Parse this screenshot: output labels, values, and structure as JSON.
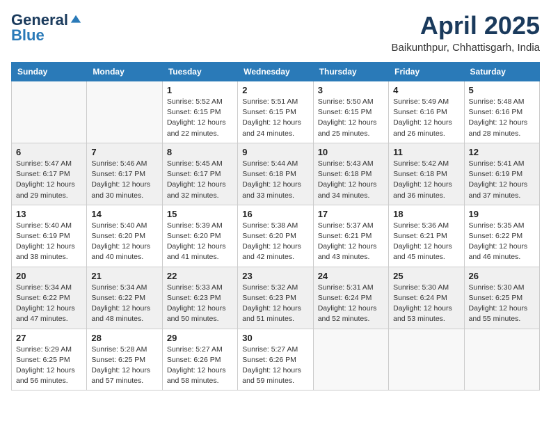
{
  "logo": {
    "general": "General",
    "blue": "Blue"
  },
  "header": {
    "title": "April 2025",
    "subtitle": "Baikunthpur, Chhattisgarh, India"
  },
  "weekdays": [
    "Sunday",
    "Monday",
    "Tuesday",
    "Wednesday",
    "Thursday",
    "Friday",
    "Saturday"
  ],
  "weeks": [
    [
      {
        "day": "",
        "sunrise": "",
        "sunset": "",
        "daylight": ""
      },
      {
        "day": "",
        "sunrise": "",
        "sunset": "",
        "daylight": ""
      },
      {
        "day": "1",
        "sunrise": "Sunrise: 5:52 AM",
        "sunset": "Sunset: 6:15 PM",
        "daylight": "Daylight: 12 hours and 22 minutes."
      },
      {
        "day": "2",
        "sunrise": "Sunrise: 5:51 AM",
        "sunset": "Sunset: 6:15 PM",
        "daylight": "Daylight: 12 hours and 24 minutes."
      },
      {
        "day": "3",
        "sunrise": "Sunrise: 5:50 AM",
        "sunset": "Sunset: 6:15 PM",
        "daylight": "Daylight: 12 hours and 25 minutes."
      },
      {
        "day": "4",
        "sunrise": "Sunrise: 5:49 AM",
        "sunset": "Sunset: 6:16 PM",
        "daylight": "Daylight: 12 hours and 26 minutes."
      },
      {
        "day": "5",
        "sunrise": "Sunrise: 5:48 AM",
        "sunset": "Sunset: 6:16 PM",
        "daylight": "Daylight: 12 hours and 28 minutes."
      }
    ],
    [
      {
        "day": "6",
        "sunrise": "Sunrise: 5:47 AM",
        "sunset": "Sunset: 6:17 PM",
        "daylight": "Daylight: 12 hours and 29 minutes."
      },
      {
        "day": "7",
        "sunrise": "Sunrise: 5:46 AM",
        "sunset": "Sunset: 6:17 PM",
        "daylight": "Daylight: 12 hours and 30 minutes."
      },
      {
        "day": "8",
        "sunrise": "Sunrise: 5:45 AM",
        "sunset": "Sunset: 6:17 PM",
        "daylight": "Daylight: 12 hours and 32 minutes."
      },
      {
        "day": "9",
        "sunrise": "Sunrise: 5:44 AM",
        "sunset": "Sunset: 6:18 PM",
        "daylight": "Daylight: 12 hours and 33 minutes."
      },
      {
        "day": "10",
        "sunrise": "Sunrise: 5:43 AM",
        "sunset": "Sunset: 6:18 PM",
        "daylight": "Daylight: 12 hours and 34 minutes."
      },
      {
        "day": "11",
        "sunrise": "Sunrise: 5:42 AM",
        "sunset": "Sunset: 6:18 PM",
        "daylight": "Daylight: 12 hours and 36 minutes."
      },
      {
        "day": "12",
        "sunrise": "Sunrise: 5:41 AM",
        "sunset": "Sunset: 6:19 PM",
        "daylight": "Daylight: 12 hours and 37 minutes."
      }
    ],
    [
      {
        "day": "13",
        "sunrise": "Sunrise: 5:40 AM",
        "sunset": "Sunset: 6:19 PM",
        "daylight": "Daylight: 12 hours and 38 minutes."
      },
      {
        "day": "14",
        "sunrise": "Sunrise: 5:40 AM",
        "sunset": "Sunset: 6:20 PM",
        "daylight": "Daylight: 12 hours and 40 minutes."
      },
      {
        "day": "15",
        "sunrise": "Sunrise: 5:39 AM",
        "sunset": "Sunset: 6:20 PM",
        "daylight": "Daylight: 12 hours and 41 minutes."
      },
      {
        "day": "16",
        "sunrise": "Sunrise: 5:38 AM",
        "sunset": "Sunset: 6:20 PM",
        "daylight": "Daylight: 12 hours and 42 minutes."
      },
      {
        "day": "17",
        "sunrise": "Sunrise: 5:37 AM",
        "sunset": "Sunset: 6:21 PM",
        "daylight": "Daylight: 12 hours and 43 minutes."
      },
      {
        "day": "18",
        "sunrise": "Sunrise: 5:36 AM",
        "sunset": "Sunset: 6:21 PM",
        "daylight": "Daylight: 12 hours and 45 minutes."
      },
      {
        "day": "19",
        "sunrise": "Sunrise: 5:35 AM",
        "sunset": "Sunset: 6:22 PM",
        "daylight": "Daylight: 12 hours and 46 minutes."
      }
    ],
    [
      {
        "day": "20",
        "sunrise": "Sunrise: 5:34 AM",
        "sunset": "Sunset: 6:22 PM",
        "daylight": "Daylight: 12 hours and 47 minutes."
      },
      {
        "day": "21",
        "sunrise": "Sunrise: 5:34 AM",
        "sunset": "Sunset: 6:22 PM",
        "daylight": "Daylight: 12 hours and 48 minutes."
      },
      {
        "day": "22",
        "sunrise": "Sunrise: 5:33 AM",
        "sunset": "Sunset: 6:23 PM",
        "daylight": "Daylight: 12 hours and 50 minutes."
      },
      {
        "day": "23",
        "sunrise": "Sunrise: 5:32 AM",
        "sunset": "Sunset: 6:23 PM",
        "daylight": "Daylight: 12 hours and 51 minutes."
      },
      {
        "day": "24",
        "sunrise": "Sunrise: 5:31 AM",
        "sunset": "Sunset: 6:24 PM",
        "daylight": "Daylight: 12 hours and 52 minutes."
      },
      {
        "day": "25",
        "sunrise": "Sunrise: 5:30 AM",
        "sunset": "Sunset: 6:24 PM",
        "daylight": "Daylight: 12 hours and 53 minutes."
      },
      {
        "day": "26",
        "sunrise": "Sunrise: 5:30 AM",
        "sunset": "Sunset: 6:25 PM",
        "daylight": "Daylight: 12 hours and 55 minutes."
      }
    ],
    [
      {
        "day": "27",
        "sunrise": "Sunrise: 5:29 AM",
        "sunset": "Sunset: 6:25 PM",
        "daylight": "Daylight: 12 hours and 56 minutes."
      },
      {
        "day": "28",
        "sunrise": "Sunrise: 5:28 AM",
        "sunset": "Sunset: 6:25 PM",
        "daylight": "Daylight: 12 hours and 57 minutes."
      },
      {
        "day": "29",
        "sunrise": "Sunrise: 5:27 AM",
        "sunset": "Sunset: 6:26 PM",
        "daylight": "Daylight: 12 hours and 58 minutes."
      },
      {
        "day": "30",
        "sunrise": "Sunrise: 5:27 AM",
        "sunset": "Sunset: 6:26 PM",
        "daylight": "Daylight: 12 hours and 59 minutes."
      },
      {
        "day": "",
        "sunrise": "",
        "sunset": "",
        "daylight": ""
      },
      {
        "day": "",
        "sunrise": "",
        "sunset": "",
        "daylight": ""
      },
      {
        "day": "",
        "sunrise": "",
        "sunset": "",
        "daylight": ""
      }
    ]
  ]
}
